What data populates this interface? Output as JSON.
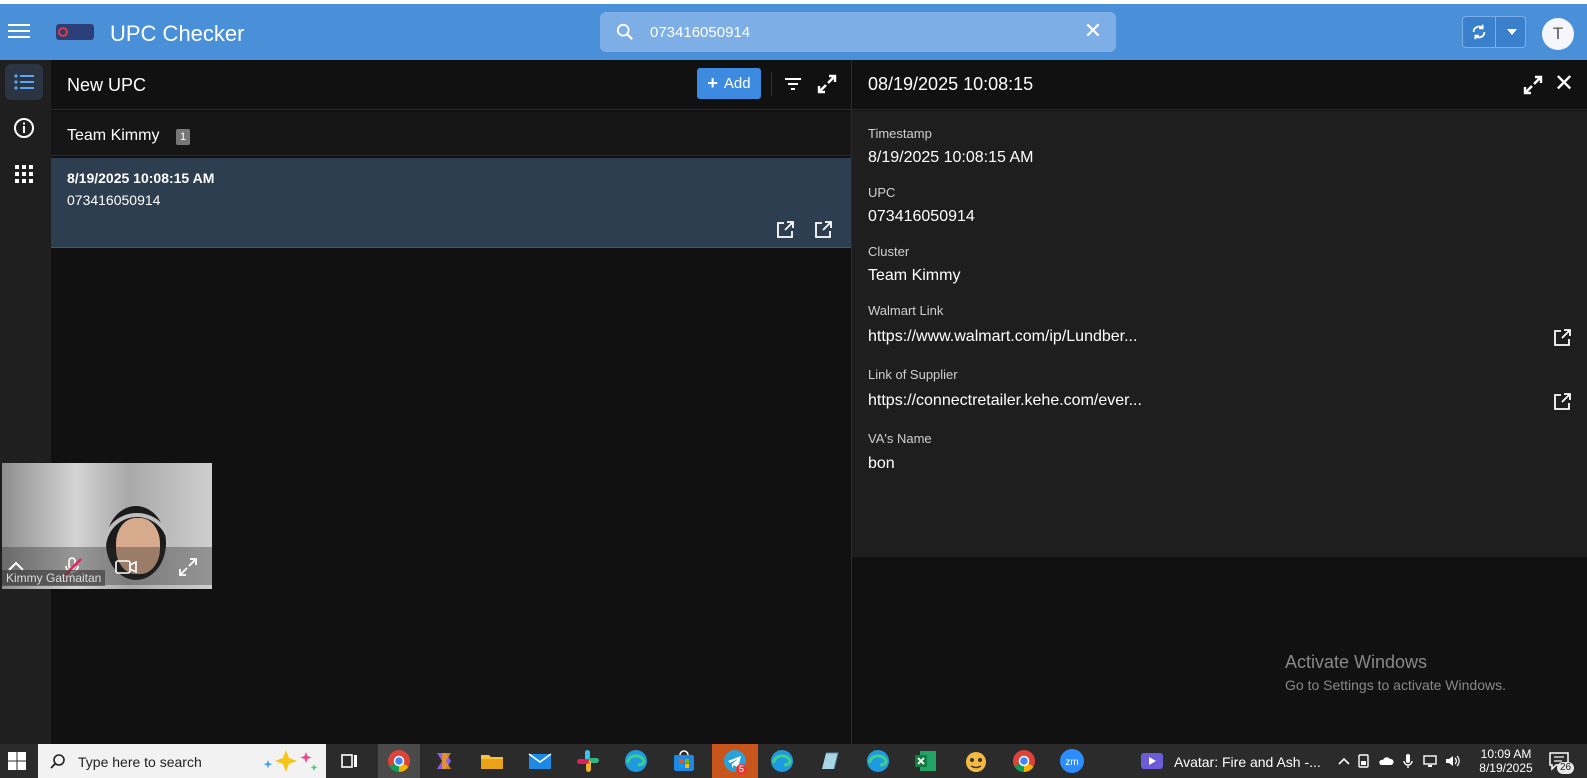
{
  "header": {
    "app_title": "UPC Checker",
    "search_value": "073416050914",
    "avatar_initial": "T",
    "accent": "#4a90d9"
  },
  "rail": {
    "items": [
      {
        "icon": "list-icon",
        "active": true
      },
      {
        "icon": "info-icon",
        "active": false
      },
      {
        "icon": "apps-grid-icon",
        "active": false
      }
    ]
  },
  "list": {
    "title": "New UPC",
    "add_label": "Add",
    "group": {
      "label": "Team Kimmy",
      "count": "1"
    },
    "items": [
      {
        "timestamp": "8/19/2025 10:08:15 AM",
        "upc": "073416050914"
      }
    ]
  },
  "detail": {
    "title": "08/19/2025 10:08:15",
    "fields": {
      "timestamp_label": "Timestamp",
      "timestamp_value": "8/19/2025 10:08:15 AM",
      "upc_label": "UPC",
      "upc_value": "073416050914",
      "cluster_label": "Cluster",
      "cluster_value": "Team Kimmy",
      "walmart_label": "Walmart Link",
      "walmart_value": "https://www.walmart.com/ip/Lundber...",
      "supplier_label": "Link of Supplier",
      "supplier_value": "https://connectretailer.kehe.com/ever...",
      "va_label": "VA's Name",
      "va_value": "bon"
    }
  },
  "watermark": {
    "line1": "Activate Windows",
    "line2": "Go to Settings to activate Windows."
  },
  "video": {
    "participant_name": "Kimmy Gatmaitan"
  },
  "taskbar": {
    "search_placeholder": "Type here to search",
    "media_title": "Avatar: Fire and Ash -...",
    "telegram_badge": "5",
    "time": "10:09 AM",
    "date": "8/19/2025",
    "notification_count": "26"
  }
}
